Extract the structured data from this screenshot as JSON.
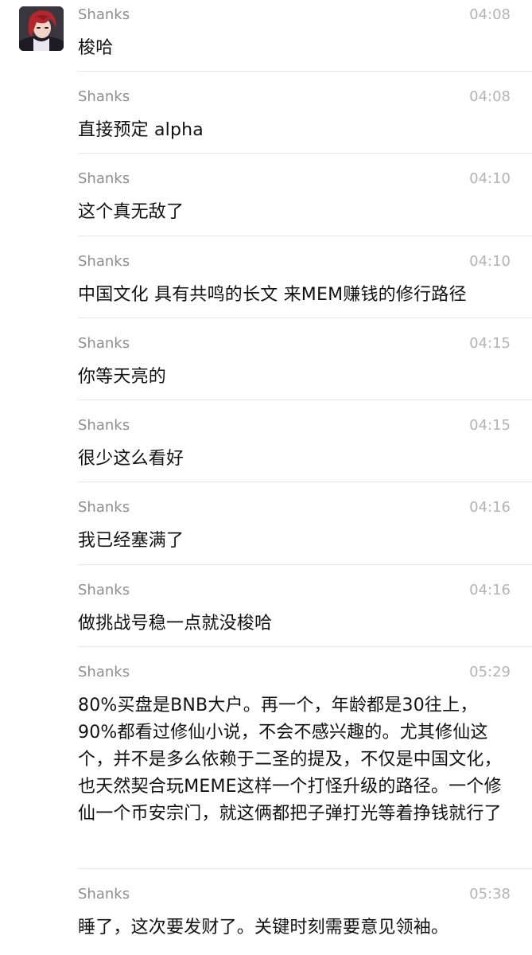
{
  "messages": [
    {
      "sender": "Shanks",
      "time": "04:08",
      "text": "梭哈"
    },
    {
      "sender": "Shanks",
      "time": "04:08",
      "text": "直接预定 alpha"
    },
    {
      "sender": "Shanks",
      "time": "04:10",
      "text": "这个真无敌了"
    },
    {
      "sender": "Shanks",
      "time": "04:10",
      "text": "中国文化 具有共鸣的长文 来MEM赚钱的修行路径"
    },
    {
      "sender": "Shanks",
      "time": "04:15",
      "text": "你等天亮的"
    },
    {
      "sender": "Shanks",
      "time": "04:15",
      "text": "很少这么看好"
    },
    {
      "sender": "Shanks",
      "time": "04:16",
      "text": "我已经塞满了"
    },
    {
      "sender": "Shanks",
      "time": "04:16",
      "text": "做挑战号稳一点就没梭哈"
    },
    {
      "sender": "Shanks",
      "time": "05:29",
      "text": "80%买盘是BNB大户。再一个，年龄都是30往上，90%都看过修仙小说，不会不感兴趣的。尤其修仙这个，并不是多么依赖于二圣的提及，不仅是中国文化，也天然契合玩MEME这样一个打怪升级的路径。一个修仙一个币安宗门，就这俩都把子弹打光等着挣钱就行了"
    },
    {
      "sender": "Shanks",
      "time": "05:38",
      "text": "睡了，这次要发财了。关键时刻需要意见领袖。"
    }
  ],
  "avatar": {
    "icon": "user-avatar-red-hair"
  }
}
